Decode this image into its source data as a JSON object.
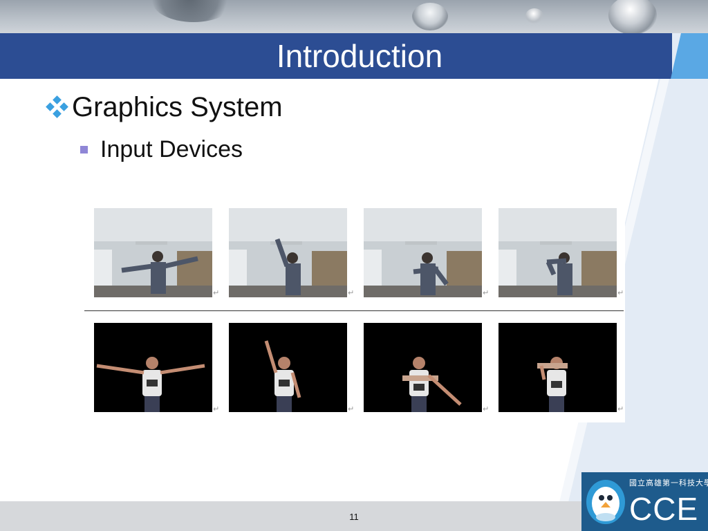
{
  "slide": {
    "title": "Introduction",
    "bullet_level1": "Graphics System",
    "bullet_level2": "Input Devices",
    "page_number": "11"
  },
  "figure": {
    "return_mark": "↵",
    "top_row": [
      {
        "pose": "arms-outstretched",
        "name": "camera-frame-1"
      },
      {
        "pose": "right-arm-raised",
        "name": "camera-frame-2"
      },
      {
        "pose": "arms-crossed",
        "name": "camera-frame-3"
      },
      {
        "pose": "hand-to-face",
        "name": "camera-frame-4"
      }
    ],
    "bottom_row": [
      {
        "pose": "arms-outstretched",
        "name": "avatar-frame-1"
      },
      {
        "pose": "right-arm-raised",
        "name": "avatar-frame-2"
      },
      {
        "pose": "arm-down-diagonal",
        "name": "avatar-frame-3"
      },
      {
        "pose": "hand-to-face",
        "name": "avatar-frame-4"
      }
    ]
  },
  "logo": {
    "text": "CCE",
    "subtitle": "國立高雄第一科技大學"
  },
  "colors": {
    "title_bar": "#2c4d93",
    "title_accent": "#5aa8e4",
    "bullet_diamond": "#3aa0e0",
    "bullet_square": "#8f86d6",
    "footer": "#d6d8db",
    "logo_bg": "#1e5b8c"
  }
}
